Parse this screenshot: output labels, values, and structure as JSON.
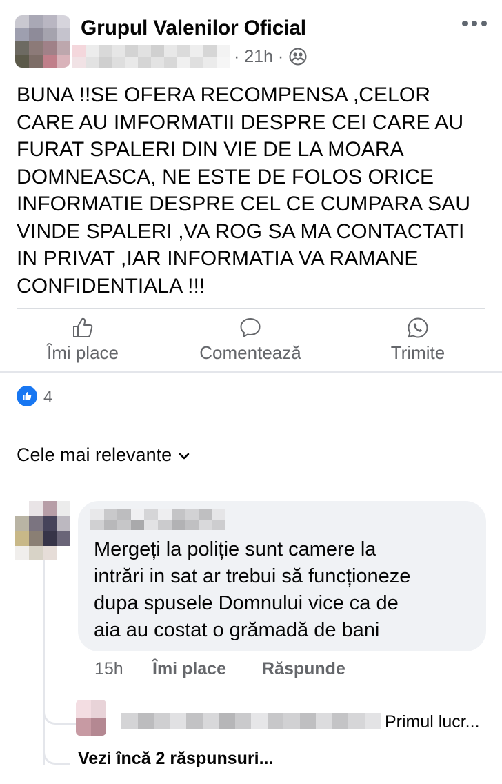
{
  "post": {
    "group_name": "Grupul Valenilor Oficial",
    "time": "· 21h ·",
    "text": "BUNA !!SE OFERA RECOMPENSA ,CELOR\nCARE AU IMFORMATII DESPRE CEI CARE AU\nFURAT SPALERI DIN VIE DE LA MOARA\nDOMNEASCA, NE ESTE DE FOLOS ORICE\nINFORMATIE DESPRE CEL CE CUMPARA SAU\nVINDE SPALERI ,VA ROG SA MA CONTACTATI\nIN PRIVAT ,IAR INFORMATIA VA RAMANE\nCONFIDENTIALA !!!"
  },
  "actions": {
    "like": "Îmi place",
    "comment": "Comentează",
    "share": "Trimite"
  },
  "reactions": {
    "count": "4"
  },
  "sort": {
    "label": "Cele mai relevante"
  },
  "comment": {
    "text": "Mergeți la poliție  sunt camere la\nintrări in sat  ar trebui să  funcționeze\ndupa spusele  Domnului vice  ca de\naia au costat o grămadă de bani",
    "time": "15h",
    "like": "Îmi place",
    "reply": "Răspunde"
  },
  "reply_preview": {
    "text": "Primul lucr..."
  },
  "more_replies": {
    "label": "Vezi încă 2 răspunsuri..."
  },
  "icons": {
    "more": "more-horizontal-icon",
    "audience": "group-audience-icon",
    "like": "thumbs-up-icon",
    "comment": "speech-bubble-icon",
    "share": "whatsapp-icon",
    "sort": "chevron-down-icon"
  },
  "colors": {
    "accent": "#1877f2",
    "secondary_text": "#65676b",
    "bubble": "#f0f2f5",
    "divider": "#dadde1"
  }
}
